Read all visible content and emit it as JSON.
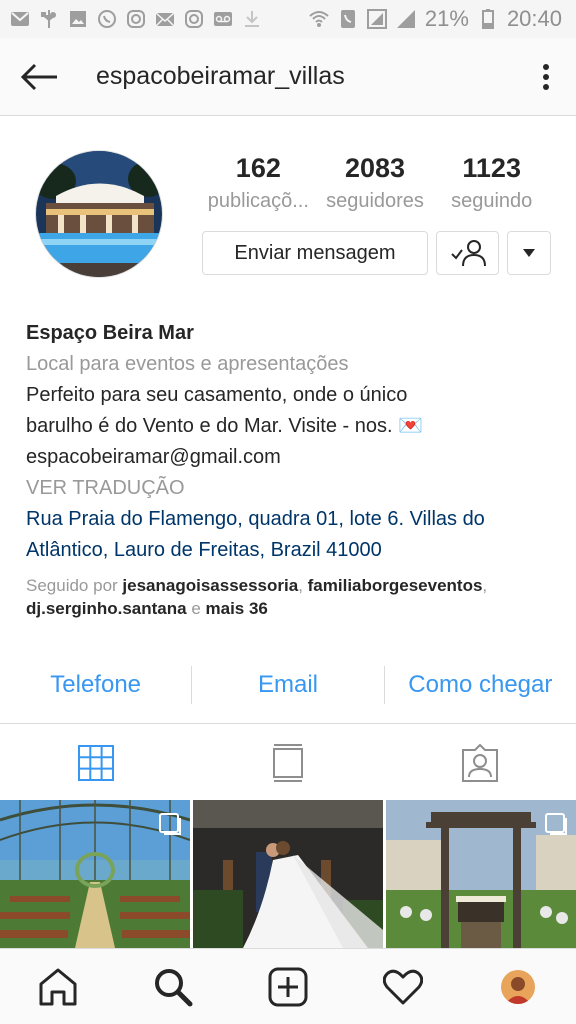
{
  "status_bar": {
    "battery": "21%",
    "time": "20:40"
  },
  "header": {
    "username": "espacobeiramar_villas"
  },
  "stats": [
    {
      "value": "162",
      "label": "publicaçõ..."
    },
    {
      "value": "2083",
      "label": "seguidores"
    },
    {
      "value": "1123",
      "label": "seguindo"
    }
  ],
  "buttons": {
    "message": "Enviar mensagem"
  },
  "bio": {
    "name": "Espaço Beira Mar",
    "category": "Local para eventos e apresentações",
    "line1": "Perfeito para seu casamento, onde o único",
    "line2": "barulho é do Vento e do Mar. Visite - nos. 💌",
    "email": "espacobeiramar@gmail.com",
    "translate": "VER TRADUÇÃO",
    "address1": "Rua Praia do Flamengo, quadra 01, lote 6. Villas do",
    "address2": "Atlântico, Lauro de Freitas, Brazil 41000"
  },
  "followed_by": {
    "prefix": "Seguido por ",
    "user1": "jesanagoisassessoria",
    "sep1": ", ",
    "user2": "familiaborgeseventos",
    "sep2": ",",
    "user3": "dj.serginho.santana",
    "sep3": " e ",
    "more": "mais 36"
  },
  "contact": {
    "phone": "Telefone",
    "email": "Email",
    "directions": "Como chegar"
  },
  "icons": {
    "status_left": [
      "message-icon",
      "usb-icon",
      "image-icon",
      "whatsapp-icon",
      "instagram-icon",
      "mail-icon",
      "instagram-icon",
      "voicemail-icon",
      "download-icon"
    ],
    "status_right": [
      "wifi-icon",
      "phone-icon",
      "data-icon",
      "signal-icon",
      "battery-icon"
    ],
    "tabs": [
      "grid-icon",
      "feed-icon",
      "tagged-icon"
    ],
    "nav": [
      "home-icon",
      "search-icon",
      "add-icon",
      "heart-icon",
      "profile-avatar"
    ]
  },
  "colors": {
    "link_blue": "#3897f0",
    "address_blue": "#003569",
    "grid_tab_active": "#3897f0"
  }
}
